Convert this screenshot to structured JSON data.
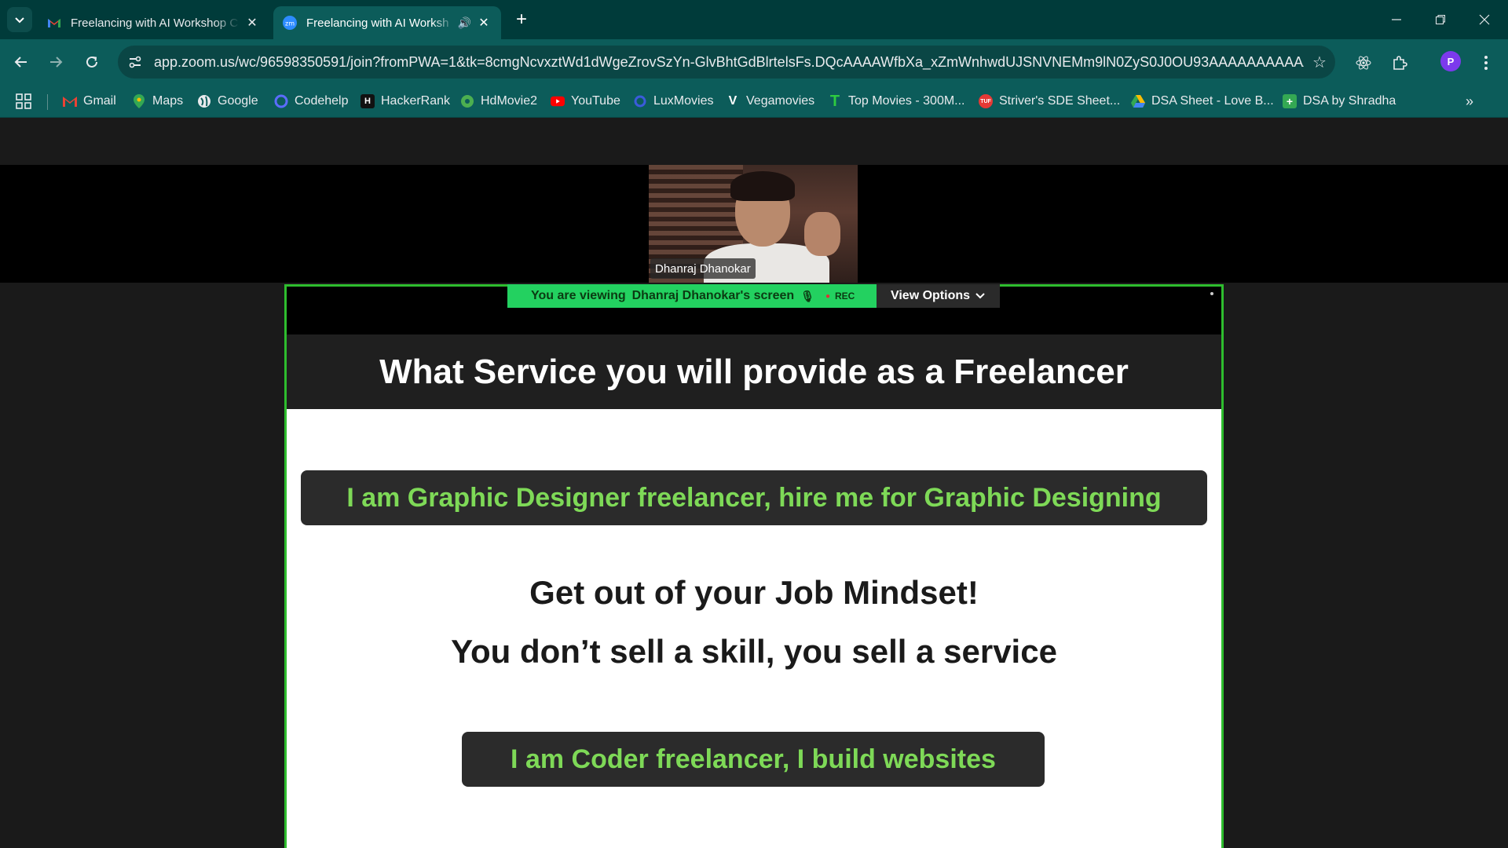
{
  "browser": {
    "tabs": [
      {
        "title": "Freelancing with AI Workshop C",
        "favicon": "gmail-icon",
        "active": false
      },
      {
        "title": "Freelancing with AI Worksh",
        "favicon": "zoom-icon",
        "active": true,
        "audio": true
      }
    ],
    "url": "app.zoom.us/wc/96598350591/join?fromPWA=1&tk=8cmgNcvxztWd1dWgeZrovSzYn-GlvBhtGdBlrtelsFs.DQcAAAAWfbXa_xZmWnhwdUJSNVNEMm9lN0ZyS0J0OU93AAAAAAAAAAAAAA...",
    "profile_initial": "P",
    "bookmarks": [
      {
        "label": "Gmail",
        "icon": "gmail-icon",
        "color": "#ea4335"
      },
      {
        "label": "Maps",
        "icon": "maps-icon",
        "color": "#34a853"
      },
      {
        "label": "Google",
        "icon": "globe-icon",
        "color": "#e8eaed"
      },
      {
        "label": "Codehelp",
        "icon": "codehelp-icon",
        "color": "#4f6bff"
      },
      {
        "label": "HackerRank",
        "icon": "hackerrank-icon",
        "color": "#0e141e"
      },
      {
        "label": "HdMovie2",
        "icon": "hdmovie-icon",
        "color": "#4caf50"
      },
      {
        "label": "YouTube",
        "icon": "youtube-icon",
        "color": "#ff0000"
      },
      {
        "label": "LuxMovies",
        "icon": "luxmovies-icon",
        "color": "#3b5bdb"
      },
      {
        "label": "Vegamovies",
        "icon": "vegamovies-icon",
        "color": "#ffffff"
      },
      {
        "label": "Top Movies - 300M...",
        "icon": "topmovies-icon",
        "color": "#2ecc40"
      },
      {
        "label": "Striver's SDE Sheet...",
        "icon": "tuf-icon",
        "color": "#e53935"
      },
      {
        "label": "DSA Sheet - Love B...",
        "icon": "drive-icon",
        "color": "#fbbc04"
      },
      {
        "label": "DSA by Shradha",
        "icon": "sheets-icon",
        "color": "#34a853"
      }
    ]
  },
  "zoom": {
    "participant_name": "Dhanraj Dhanokar",
    "viewing_label": "You are viewing",
    "viewing_name": "Dhanraj Dhanokar's screen",
    "rec_label": "REC",
    "view_options_label": "View Options"
  },
  "slide": {
    "title": "What Service you will provide as a Freelancer",
    "pill_1": "I am Graphic Designer freelancer, hire me for Graphic Designing",
    "line_1": "Get out of your Job Mindset!",
    "line_2": "You don’t sell a skill, you sell a service",
    "pill_2": "I am Coder freelancer, I build websites"
  },
  "colors": {
    "chrome_dark": "#003b3a",
    "chrome_toolbar": "#0c5c5a",
    "share_border": "#2ebd2e",
    "viewing_bar": "#23d160",
    "pill_text": "#7ed957"
  }
}
